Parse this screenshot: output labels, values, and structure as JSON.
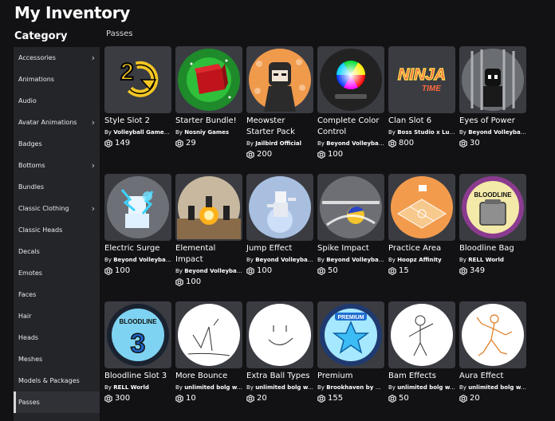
{
  "page": {
    "title": "My Inventory"
  },
  "sidebar": {
    "heading": "Category",
    "items": [
      {
        "label": "Accessories",
        "chevron": true
      },
      {
        "label": "Animations",
        "chevron": false
      },
      {
        "label": "Audio",
        "chevron": false
      },
      {
        "label": "Avatar Animations",
        "chevron": true
      },
      {
        "label": "Badges",
        "chevron": false
      },
      {
        "label": "Bottoms",
        "chevron": true
      },
      {
        "label": "Bundles",
        "chevron": false
      },
      {
        "label": "Classic Clothing",
        "chevron": true
      },
      {
        "label": "Classic Heads",
        "chevron": false
      },
      {
        "label": "Decals",
        "chevron": false
      },
      {
        "label": "Emotes",
        "chevron": false
      },
      {
        "label": "Faces",
        "chevron": false
      },
      {
        "label": "Hair",
        "chevron": false
      },
      {
        "label": "Heads",
        "chevron": false
      },
      {
        "label": "Meshes",
        "chevron": false
      },
      {
        "label": "Models & Packages",
        "chevron": false
      },
      {
        "label": "Passes",
        "chevron": false,
        "active": true
      }
    ]
  },
  "section": {
    "title": "Passes"
  },
  "currency_icon": "robux-icon",
  "items": [
    {
      "name": "Style Slot 2",
      "by": "By",
      "creator": "Volleyball Game ...",
      "price": "149",
      "icon": "style-slot-2-icon"
    },
    {
      "name": "Starter Bundle!",
      "by": "By",
      "creator": "Nosniy Games",
      "price": "29",
      "icon": "starter-bundle-icon"
    },
    {
      "name": "Meowster Starter Pack",
      "by": "By",
      "creator": "Jailbird Official",
      "price": "200",
      "icon": "meowster-icon"
    },
    {
      "name": "Complete Color Control",
      "by": "By",
      "creator": "Beyond Volleybal...",
      "price": "100",
      "icon": "color-wheel-icon"
    },
    {
      "name": "Clan Slot 6",
      "by": "By",
      "creator": "Boss Studio x Lux...",
      "price": "800",
      "icon": "ninja-time-icon"
    },
    {
      "name": "Eyes of Power",
      "by": "By",
      "creator": "Beyond Volleybal...",
      "price": "30",
      "icon": "eyes-of-power-icon"
    },
    {
      "name": "Electric Surge",
      "by": "By",
      "creator": "Beyond Volleybal...",
      "price": "100",
      "icon": "electric-surge-icon"
    },
    {
      "name": "Elemental Impact",
      "by": "By",
      "creator": "Beyond Volleybal...",
      "price": "100",
      "icon": "elemental-impact-icon"
    },
    {
      "name": "Jump Effect",
      "by": "By",
      "creator": "Beyond Volleybal...",
      "price": "100",
      "icon": "jump-effect-icon"
    },
    {
      "name": "Spike Impact",
      "by": "By",
      "creator": "Beyond Volleybal...",
      "price": "50",
      "icon": "spike-impact-icon"
    },
    {
      "name": "Practice Area",
      "by": "By",
      "creator": "Hoopz Affinity",
      "price": "15",
      "icon": "basketball-court-icon"
    },
    {
      "name": "Bloodline Bag",
      "by": "By",
      "creator": "RELL World",
      "price": "349",
      "icon": "bloodline-bag-icon"
    },
    {
      "name": "Bloodline Slot 3",
      "by": "By",
      "creator": "RELL World",
      "price": "300",
      "icon": "bloodline-3-icon"
    },
    {
      "name": "More Bounce",
      "by": "By",
      "creator": "unlimited bolg w...",
      "price": "10",
      "icon": "stick-sketch-icon"
    },
    {
      "name": "Extra Ball Types",
      "by": "By",
      "creator": "unlimited bolg w...",
      "price": "20",
      "icon": "smiley-icon"
    },
    {
      "name": "Premium",
      "by": "By",
      "creator": "Brookhaven by V...",
      "price": "155",
      "icon": "premium-star-icon"
    },
    {
      "name": "Bam Effects",
      "by": "By",
      "creator": "unlimited bolg w...",
      "price": "50",
      "icon": "stick-figure-icon"
    },
    {
      "name": "Aura Effect",
      "by": "By",
      "creator": "unlimited bolg w...",
      "price": "20",
      "icon": "orange-figure-icon"
    }
  ]
}
